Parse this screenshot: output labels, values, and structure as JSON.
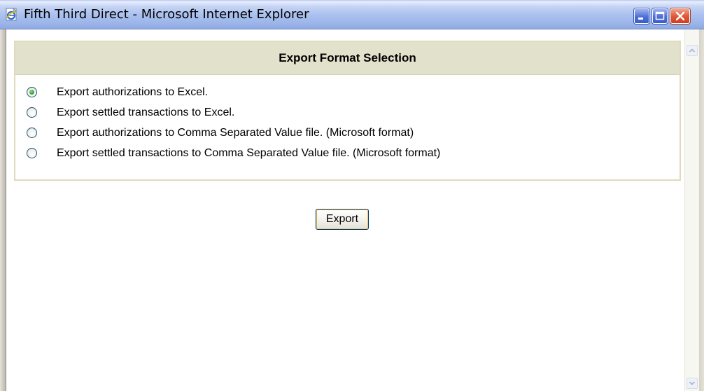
{
  "window": {
    "title": "Fifth Third Direct - Microsoft Internet Explorer",
    "app_icon": "ie-page-icon",
    "controls": [
      "minimize-icon",
      "maximize-icon",
      "close-icon"
    ]
  },
  "panel": {
    "title": "Export Format Selection",
    "selected_index": 0,
    "options": [
      {
        "label": "Export authorizations to Excel.",
        "checked": true
      },
      {
        "label": "Export settled transactions to Excel.",
        "checked": false
      },
      {
        "label": "Export authorizations to Comma Separated Value file. (Microsoft format)",
        "checked": false
      },
      {
        "label": "Export settled transactions to Comma Separated Value file. (Microsoft format)",
        "checked": false
      }
    ]
  },
  "actions": {
    "export_label": "Export"
  },
  "colors": {
    "panel_header_bg": "#e2e1cc",
    "panel_border": "#dedbbe",
    "radio_checked": "#2fa12f"
  }
}
